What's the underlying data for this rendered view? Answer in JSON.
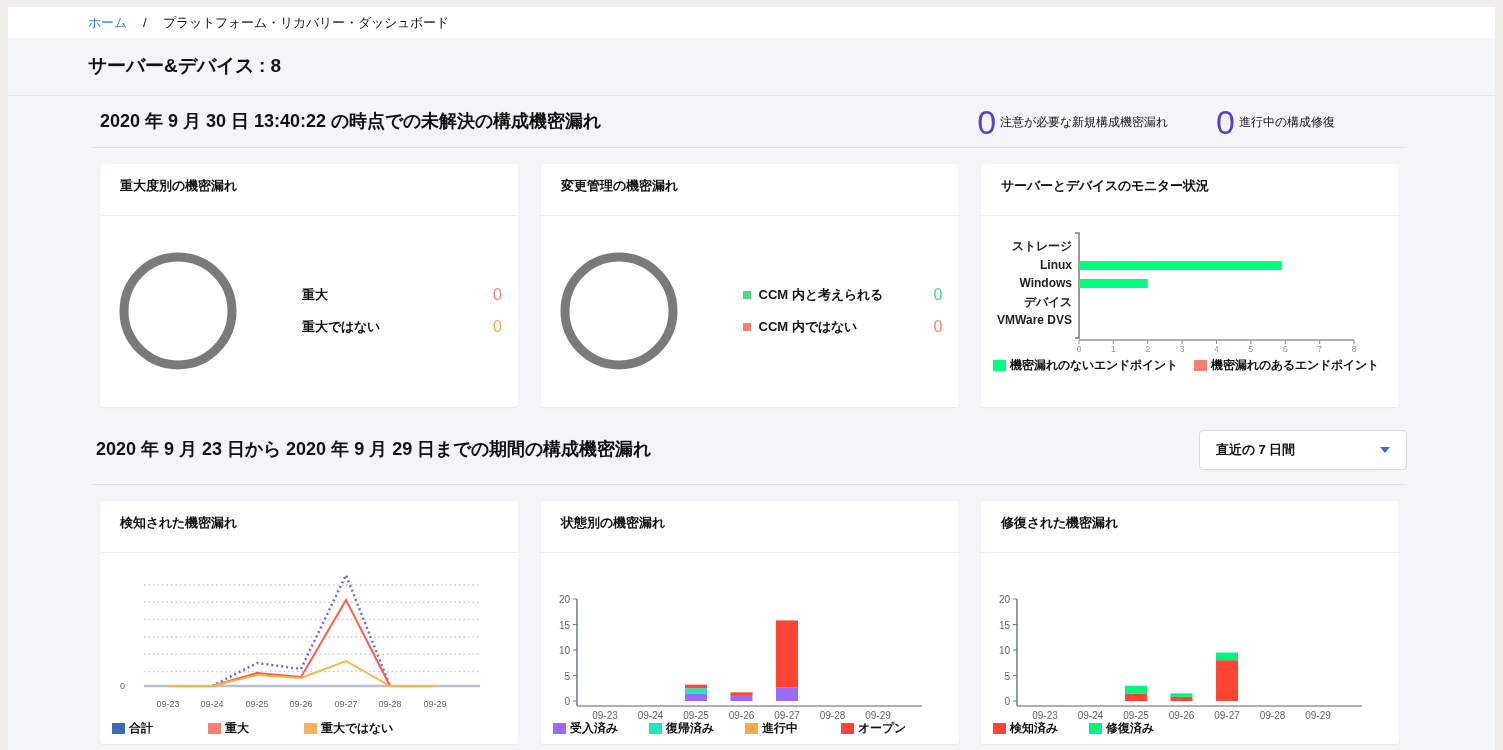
{
  "breadcrumb": [
    {
      "label": "ホーム",
      "kind": "link"
    },
    {
      "label": "/",
      "kind": "separator"
    },
    {
      "label": "プラットフォーム・リカバリー・ダッシュボード",
      "kind": "current"
    }
  ],
  "page_title": "サーバー&デバイス : 8",
  "open_section": {
    "title": "2020 年 9 月 30 日 13:40:22 の時点での未解決の構成機密漏れ",
    "counters": [
      {
        "value": "0",
        "label": "注意が必要な新規構成機密漏れ"
      },
      {
        "value": "0",
        "label": "進行中の構成修復"
      }
    ],
    "cards": [
      {
        "kind": "donut",
        "title": "重大度別の機密漏れ",
        "legend": [
          {
            "label": "重大",
            "value": "0",
            "color": "#fa8072",
            "swatch": false
          },
          {
            "label": "重大ではない",
            "value": "0",
            "color": "#ffa94d",
            "swatch": false
          }
        ]
      },
      {
        "kind": "donut",
        "title": "変更管理の機密漏れ",
        "legend": [
          {
            "label": "CCM 内と考えられる",
            "value": "0",
            "color": "#4cd97b",
            "swatch": true
          },
          {
            "label": "CCM 内ではない",
            "value": "0",
            "color": "#fa8072",
            "swatch": true
          }
        ]
      },
      {
        "kind": "chart",
        "title": "サーバーとデバイスのモニター状況",
        "chart_data": {
          "type": "bar",
          "orientation": "horizontal",
          "stacked": true,
          "categories": [
            "ストレージ",
            "Linux",
            "Windows",
            "デバイス",
            "VMWare DVS"
          ],
          "xlim": [
            0,
            8
          ],
          "legend": "bottom",
          "xticks": [
            0,
            1,
            2,
            3,
            4,
            5,
            6,
            7,
            8
          ],
          "series": [
            {
              "name": "機密漏れのないエンドポイント",
              "color": "#00ff7f",
              "values": [
                0,
                5.9,
                2,
                0,
                0
              ]
            },
            {
              "name": "機密漏れのあるエンドポイント",
              "color": "#fa8072",
              "values": [
                0,
                0,
                0,
                0,
                0
              ]
            }
          ]
        }
      }
    ]
  },
  "period_section": {
    "title": "2020 年 9 月 23 日から 2020 年 9 月 29 日までの期間の構成機密漏れ",
    "range_select": "直近の 7 日間",
    "cards": [
      {
        "kind": "lines",
        "title": "検知された機密漏れ",
        "y_label": "0",
        "x_labels": [
          "09-23",
          "09-24",
          "09-25",
          "09-26",
          "09-27",
          "09-28",
          "09-29"
        ],
        "legend": [
          {
            "label": "合計",
            "color": "#3b6db5"
          },
          {
            "label": "重大",
            "color": "#fa8072"
          },
          {
            "label": "重大ではない",
            "color": "#ffae5c"
          }
        ]
      },
      {
        "kind": "chart",
        "title": "状態別の機密漏れ",
        "chart_data": {
          "type": "bar",
          "stacked": true,
          "legend": "bottom",
          "categories": [
            "09-23",
            "09-24",
            "09-25",
            "09-26",
            "09-27",
            "09-28",
            "09-29"
          ],
          "ylim": [
            0,
            20
          ],
          "yticks": [
            0,
            5,
            10,
            15,
            20
          ],
          "series": [
            {
              "name": "受入済み",
              "color": "#9b6bff",
              "values": [
                0,
                0,
                1.5,
                1,
                2.7,
                0,
                0
              ]
            },
            {
              "name": "復帰済み",
              "color": "#1ee8c0",
              "values": [
                0,
                0,
                1,
                0,
                0,
                0,
                0
              ]
            },
            {
              "name": "進行中",
              "color": "#ffa94d",
              "values": [
                0,
                0,
                0,
                0,
                0,
                0,
                0
              ]
            },
            {
              "name": "オープン",
              "color": "#ff4433",
              "values": [
                0,
                0,
                0.7,
                0.7,
                13.1,
                0,
                0
              ]
            }
          ]
        }
      },
      {
        "kind": "chart",
        "title": "修復された機密漏れ",
        "chart_data": {
          "type": "bar",
          "stacked": true,
          "legend": "bottom",
          "categories": [
            "09-23",
            "09-24",
            "09-25",
            "09-26",
            "09-27",
            "09-28",
            "09-29"
          ],
          "ylim": [
            0,
            20
          ],
          "yticks": [
            0,
            5,
            10,
            15,
            20
          ],
          "series": [
            {
              "name": "検知済み",
              "color": "#ff4433",
              "values": [
                0,
                0,
                1.5,
                0.8,
                8,
                0,
                0
              ]
            },
            {
              "name": "修復済み",
              "color": "#00f57a",
              "values": [
                0,
                0,
                1.5,
                0.7,
                1.5,
                0,
                0
              ]
            }
          ]
        }
      }
    ]
  }
}
